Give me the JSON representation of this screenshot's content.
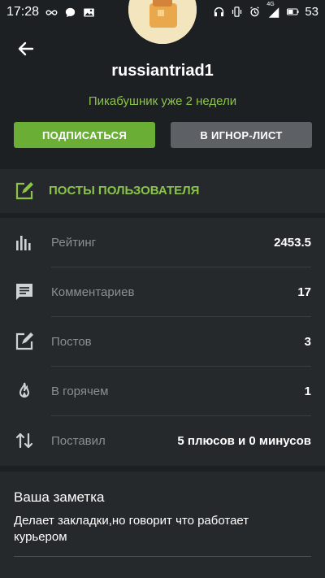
{
  "status_bar": {
    "time": "17:28",
    "network_badge": "4G",
    "battery": "53"
  },
  "profile": {
    "username": "russiantriad1",
    "since": "Пикабушник уже 2 недели"
  },
  "actions": {
    "subscribe": "ПОДПИСАТЬСЯ",
    "ignore": "В ИГНОР-ЛИСТ"
  },
  "posts_link": {
    "label": "ПОСТЫ ПОЛЬЗОВАТЕЛЯ"
  },
  "stats": [
    {
      "icon": "bar-chart-icon",
      "label": "Рейтинг",
      "value": "2453.5"
    },
    {
      "icon": "comment-icon",
      "label": "Комментариев",
      "value": "17"
    },
    {
      "icon": "edit-post-icon",
      "label": "Постов",
      "value": "3"
    },
    {
      "icon": "flame-icon",
      "label": "В горячем",
      "value": "1"
    },
    {
      "icon": "sort-arrows-icon",
      "label": "Поставил",
      "value": "5 плюсов и 0 минусов"
    }
  ],
  "note": {
    "title": "Ваша заметка",
    "text": "Делает закладки,но говорит что работает курьером"
  },
  "colors": {
    "accent_green": "#8ac448",
    "button_green": "#6aae35",
    "button_gray": "#5d6166",
    "background": "#1d2023",
    "card": "#26292c"
  }
}
